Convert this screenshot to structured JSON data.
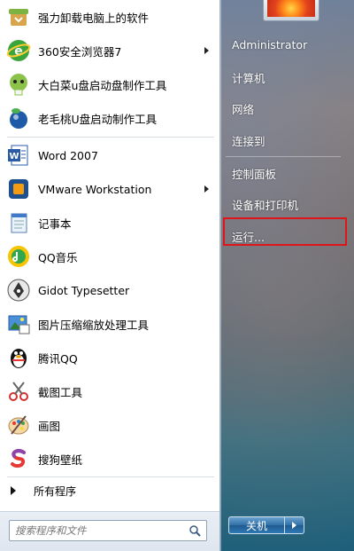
{
  "programs": [
    {
      "label": "强力卸载电脑上的软件",
      "icon": "uninstall-icon",
      "arrow": false
    },
    {
      "label": "360安全浏览器7",
      "icon": "browser-360-icon",
      "arrow": true
    },
    {
      "label": "大白菜u盘启动盘制作工具",
      "icon": "cabbage-icon",
      "arrow": false
    },
    {
      "label": "老毛桃U盘启动制作工具",
      "icon": "peach-icon",
      "arrow": false
    },
    {
      "label": "Word 2007",
      "icon": "word-icon",
      "arrow": false
    },
    {
      "label": "VMware Workstation",
      "icon": "vmware-icon",
      "arrow": true
    },
    {
      "label": "记事本",
      "icon": "notepad-icon",
      "arrow": false
    },
    {
      "label": "QQ音乐",
      "icon": "qq-music-icon",
      "arrow": false
    },
    {
      "label": "Gidot Typesetter",
      "icon": "pen-nib-icon",
      "arrow": false
    },
    {
      "label": "图片压缩缩放处理工具",
      "icon": "image-tool-icon",
      "arrow": false
    },
    {
      "label": "腾讯QQ",
      "icon": "qq-penguin-icon",
      "arrow": false
    },
    {
      "label": "截图工具",
      "icon": "scissors-icon",
      "arrow": false
    },
    {
      "label": "画图",
      "icon": "paint-palette-icon",
      "arrow": false
    },
    {
      "label": "搜狗壁纸",
      "icon": "sogou-wallpaper-icon",
      "arrow": false
    }
  ],
  "all_programs": "所有程序",
  "search": {
    "placeholder": "搜索程序和文件",
    "icon": "search-icon"
  },
  "right_menu": [
    {
      "label": "Administrator"
    },
    {
      "label": "计算机"
    },
    {
      "label": "网络"
    },
    {
      "label": "连接到"
    },
    {
      "label": "控制面板"
    },
    {
      "label": "设备和打印机"
    },
    {
      "label": "运行..."
    }
  ],
  "shutdown": {
    "label": "关机"
  },
  "colors": {
    "highlight_border": "#e0141b",
    "shutdown_button": "#2f6fa6"
  }
}
